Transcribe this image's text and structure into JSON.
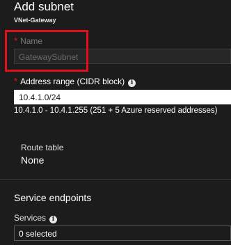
{
  "blade": {
    "title": "Add subnet",
    "subtitle": "VNet-Gateway"
  },
  "name_field": {
    "required_marker": "*",
    "label": "Name",
    "value": "GatewaySubnet",
    "disabled": true
  },
  "address_range": {
    "required_marker": "*",
    "label": "Address range (CIDR block)",
    "info_icon": "info-icon",
    "value": "10.4.1.0/24",
    "hint": "10.4.1.0 - 10.4.1.255 (251 + 5 Azure reserved addresses)"
  },
  "route_table": {
    "label": "Route table",
    "value": "None"
  },
  "service_endpoints": {
    "title": "Service endpoints",
    "services_label": "Services",
    "info_icon": "info-icon",
    "services_value": "0 selected"
  },
  "annotation": {
    "highlight_color": "#e50e1b"
  },
  "colors": {
    "background": "#1c1c1c",
    "required": "#e81123"
  }
}
